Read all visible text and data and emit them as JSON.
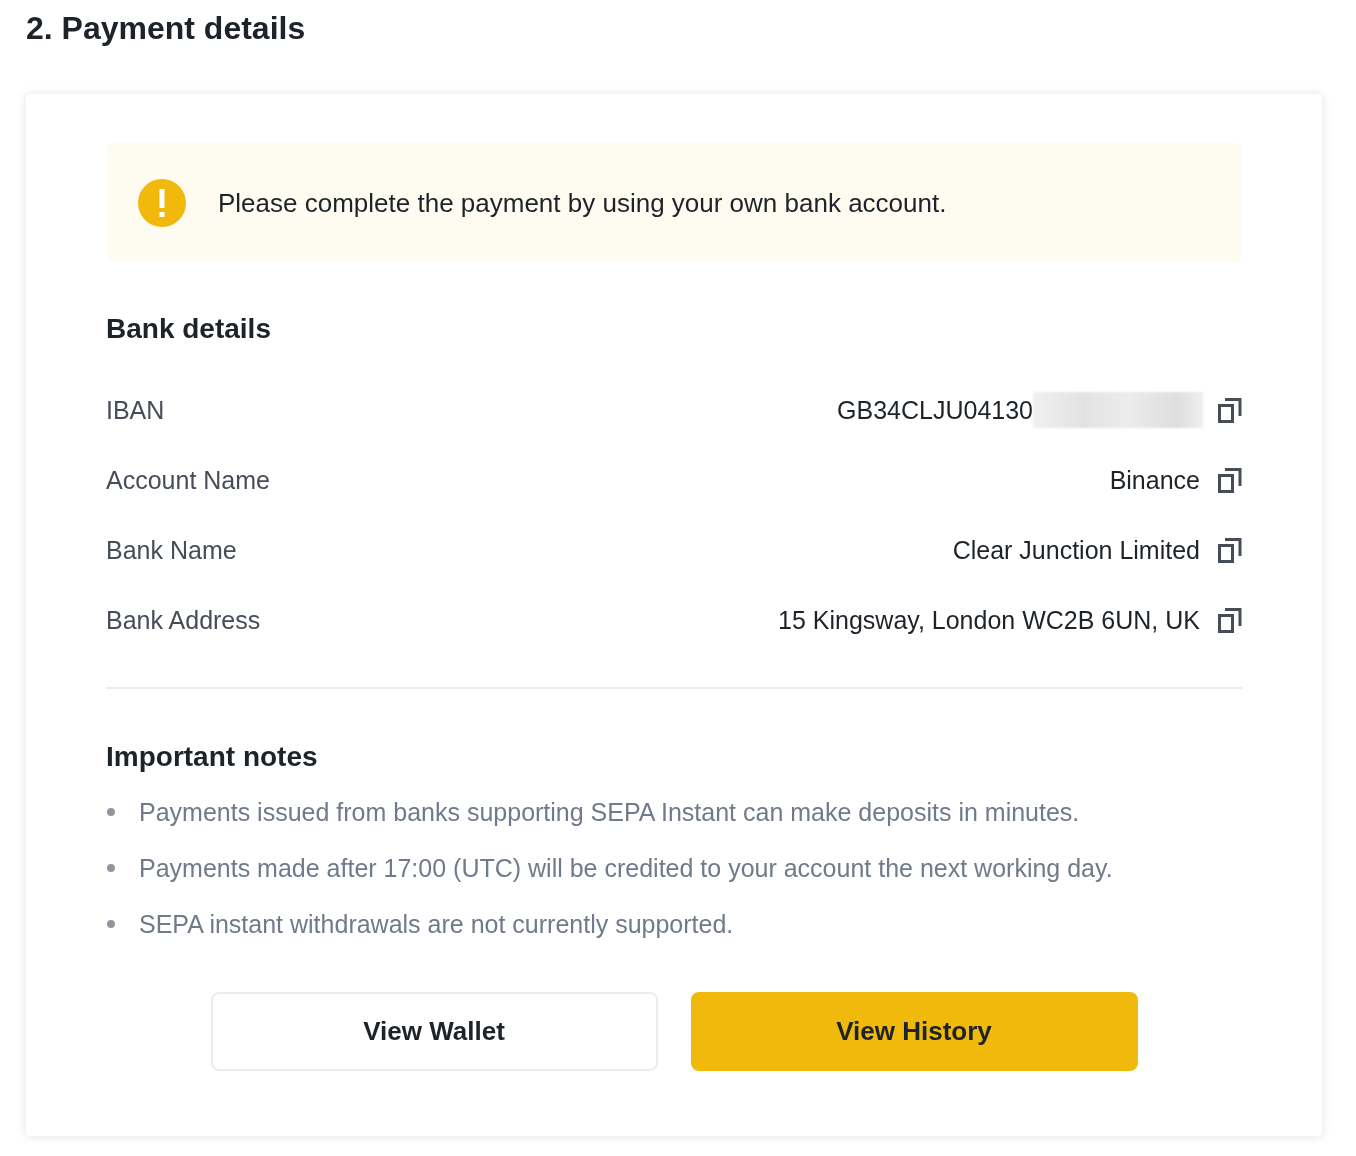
{
  "heading": "2. Payment details",
  "alert": {
    "text": "Please complete the payment by using your own bank account."
  },
  "bank_details": {
    "title": "Bank details",
    "rows": [
      {
        "label": "IBAN",
        "value": "GB34CLJU04130",
        "redacted": true
      },
      {
        "label": "Account Name",
        "value": "Binance",
        "redacted": false
      },
      {
        "label": "Bank Name",
        "value": "Clear Junction Limited",
        "redacted": false
      },
      {
        "label": "Bank Address",
        "value": "15 Kingsway, London WC2B 6UN, UK",
        "redacted": false
      }
    ]
  },
  "important_notes": {
    "title": "Important notes",
    "items": [
      "Payments issued from banks supporting SEPA Instant can make deposits in minutes.",
      "Payments made after 17:00 (UTC) will be credited to your account the next working day.",
      "SEPA instant withdrawals are not currently supported."
    ]
  },
  "buttons": [
    {
      "label": "View Wallet",
      "kind": "secondary"
    },
    {
      "label": "View History",
      "kind": "primary"
    }
  ]
}
